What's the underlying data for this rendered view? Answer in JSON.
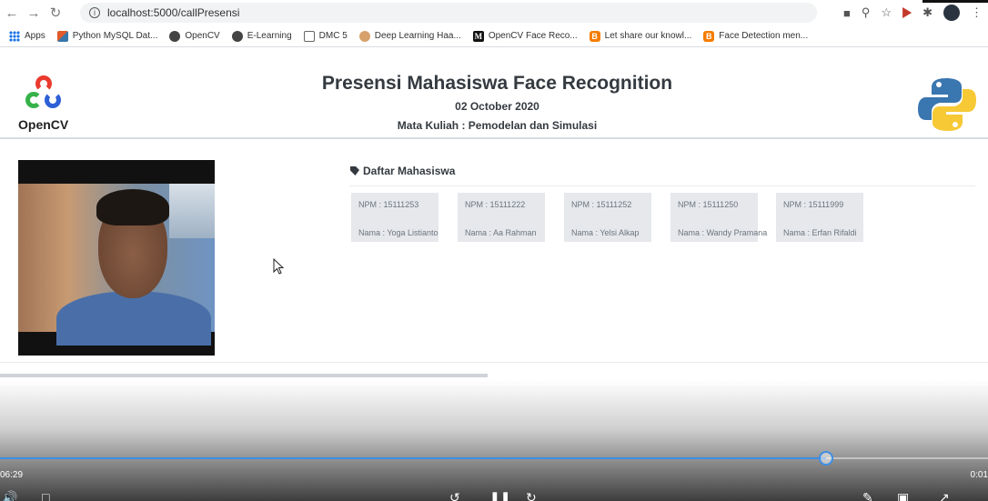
{
  "browser": {
    "url": "localhost:5000/callPresensi",
    "bookmarks": [
      {
        "label": "Apps",
        "icon": "apps-icon"
      },
      {
        "label": "Python MySQL Dat...",
        "icon": "python-icon"
      },
      {
        "label": "OpenCV",
        "icon": "globe-icon"
      },
      {
        "label": "E-Learning",
        "icon": "globe-icon"
      },
      {
        "label": "DMC 5",
        "icon": "grid-icon"
      },
      {
        "label": "Deep Learning Haa...",
        "icon": "face-icon"
      },
      {
        "label": "OpenCV Face Reco...",
        "icon": "medium-icon"
      },
      {
        "label": "Let share our knowl...",
        "icon": "blogger-icon"
      },
      {
        "label": "Face Detection men...",
        "icon": "blogger-icon"
      }
    ]
  },
  "header": {
    "logo_text": "OpenCV",
    "title": "Presensi Mahasiswa Face Recognition",
    "date": "02 October 2020",
    "subject": "Mata Kuliah : Pemodelan dan Simulasi"
  },
  "daftar": {
    "title": "Daftar Mahasiswa",
    "students": [
      {
        "npm": "NPM : 15111253",
        "nama": "Nama : Yoga Listianto"
      },
      {
        "npm": "NPM : 15111222",
        "nama": "Nama : Aa Rahman"
      },
      {
        "npm": "NPM : 15111252",
        "nama": "Nama : Yelsi Alkap"
      },
      {
        "npm": "NPM : 15111250",
        "nama": "Nama : Wandy Pramana"
      },
      {
        "npm": "NPM : 15111999",
        "nama": "Nama : Erfan Rifaldi"
      }
    ]
  },
  "player": {
    "time_elapsed": "06:29",
    "time_remaining": "0:01",
    "progress_fraction": 0.836
  },
  "colors": {
    "accent": "#3d8fe6",
    "card_bg": "#e6e8ec",
    "heading": "#343a40"
  }
}
